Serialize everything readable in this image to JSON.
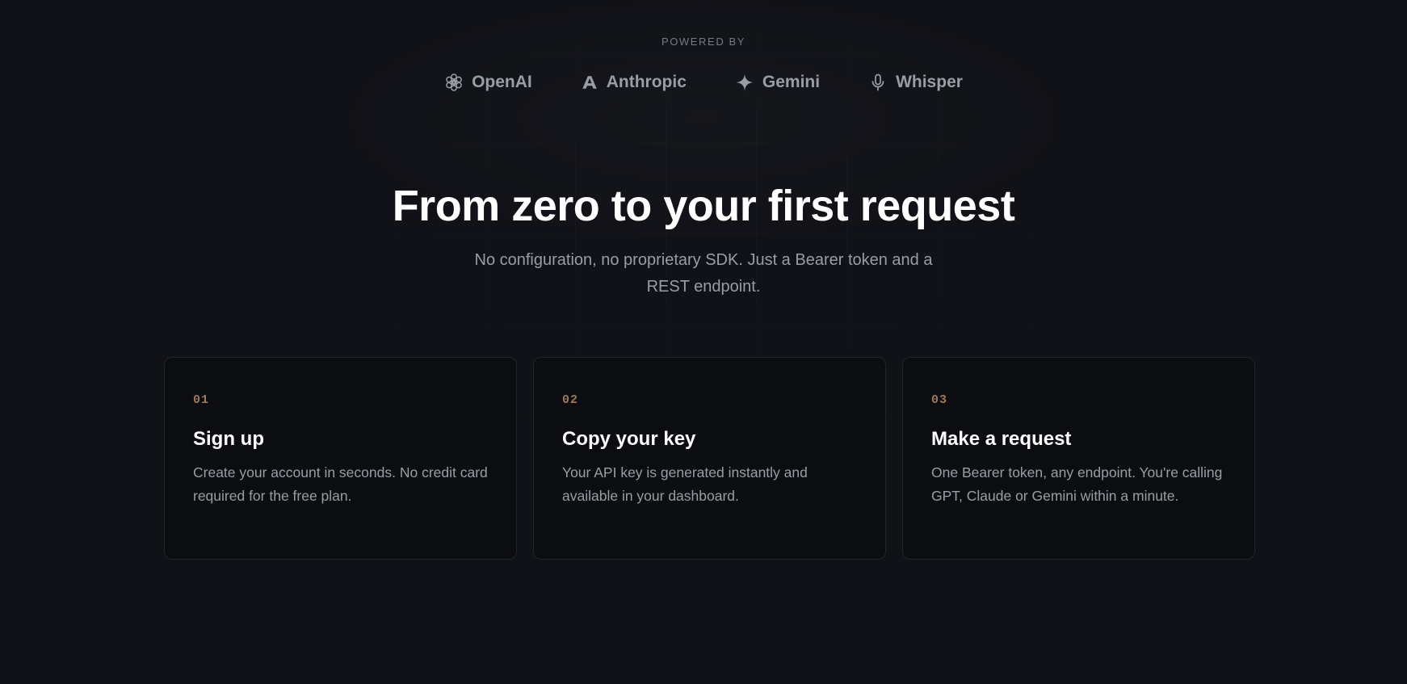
{
  "powered_by": {
    "label": "POWERED BY",
    "providers": [
      {
        "name": "OpenAI",
        "icon": "openai-icon"
      },
      {
        "name": "Anthropic",
        "icon": "anthropic-icon"
      },
      {
        "name": "Gemini",
        "icon": "gemini-sparkle-icon"
      },
      {
        "name": "Whisper",
        "icon": "microphone-icon"
      }
    ]
  },
  "hero": {
    "title": "From zero to your first request",
    "subtitle": "No configuration, no proprietary SDK. Just a Bearer token and a REST endpoint."
  },
  "steps": [
    {
      "number": "01",
      "title": "Sign up",
      "description": "Create your account in seconds. No credit card required for the free plan."
    },
    {
      "number": "02",
      "title": "Copy your key",
      "description": "Your API key is generated instantly and available in your dashboard."
    },
    {
      "number": "03",
      "title": "Make a request",
      "description": "One Bearer token, any endpoint. You're calling GPT, Claude or Gemini within a minute."
    }
  ],
  "colors": {
    "background": "#111217",
    "card_background": "#0c0d11",
    "card_border": "#22242b",
    "accent_number": "#9b7a57",
    "heading": "#ffffff",
    "muted_text": "#9a9da6"
  }
}
